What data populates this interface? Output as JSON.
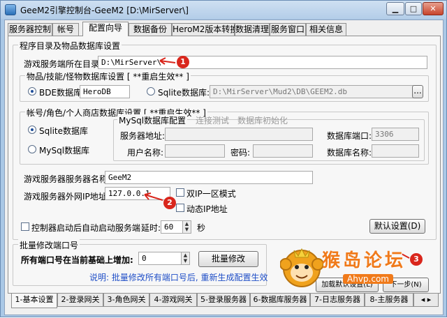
{
  "window": {
    "title": "GeeM2引擎控制台-GeeM2 [D:\\MirServer\\]",
    "min_label": "▁",
    "max_label": "□",
    "close_label": "✕"
  },
  "top_tabs": [
    {
      "label": "服务器控制"
    },
    {
      "label": "帐号"
    },
    {
      "label": "配置向导"
    },
    {
      "label": "数据备份"
    },
    {
      "label": "HeroM2版本转换"
    },
    {
      "label": "数据清理"
    },
    {
      "label": "服务窗口"
    },
    {
      "label": "相关信息"
    }
  ],
  "group_main": {
    "title": "程序目录及物品数据库设置",
    "dir_label": "游戏服务端所在目录:",
    "dir_value": "D:\\MirServer\\"
  },
  "group_items": {
    "title": "物品/技能/怪物数据库设置 [ **重启生效** ]",
    "bde_label": "BDE数据库:",
    "bde_value": "HeroDB",
    "sqlite_label": "Sqlite数据库:",
    "sqlite_value": "D:\\MirServer\\Mud2\\DB\\GEEM2.db",
    "browse_label": "..."
  },
  "group_accounts": {
    "title": "帐号/角色/个人商店数据库设置 [ **重启生效** ]",
    "sqlite_option": "Sqlite数据库",
    "mysql_option": "MySql数据库",
    "mysql_group_title": "MySql数据库配置",
    "test_link": "连接测试",
    "init_link": "数据库初始化",
    "server_addr_label": "服务器地址:",
    "db_port_label": "数据库端口:",
    "db_port_value": "3306",
    "username_label": "用户名称:",
    "password_label": "密码:",
    "db_name_label": "数据库名称:"
  },
  "server": {
    "name_label": "游戏服务器服务器名称:",
    "name_value": "GeeM2",
    "ip_label": "游戏服务器外网IP地址:",
    "ip_value": "127.0.0.1",
    "dual_ip_label": "双IP一区模式",
    "dynamic_ip_label": "动态IP地址",
    "autostart_label": "控制器启动后自动启动服务端",
    "delay_label": "延时:",
    "delay_value": "60",
    "delay_unit": "秒",
    "default_button": "默认设置(D)"
  },
  "group_batch": {
    "title": "批量修改端口号",
    "increase_label": "所有端口号在当前基础上增加:",
    "increase_value": "0",
    "batch_button": "批量修改",
    "note": "说明: 批量修改所有端口号后, 重新生成配置生效"
  },
  "nav_buttons": {
    "prev_label": "加载默认设置(L)",
    "next_label": "下一步(N)"
  },
  "bottom_tabs": [
    {
      "label": "1-基本设置"
    },
    {
      "label": "2-登录网关"
    },
    {
      "label": "3-角色网关"
    },
    {
      "label": "4-游戏网关"
    },
    {
      "label": "5-登录服务器"
    },
    {
      "label": "6-数据库服务器"
    },
    {
      "label": "7-日志服务器"
    },
    {
      "label": "8-主服务器"
    }
  ],
  "annotations": {
    "marker_1": "1",
    "marker_2": "2",
    "marker_3": "3",
    "accent_color": "#d9261c"
  },
  "watermark": {
    "text": "猴岛论坛",
    "sub": "Ahvp.com"
  }
}
